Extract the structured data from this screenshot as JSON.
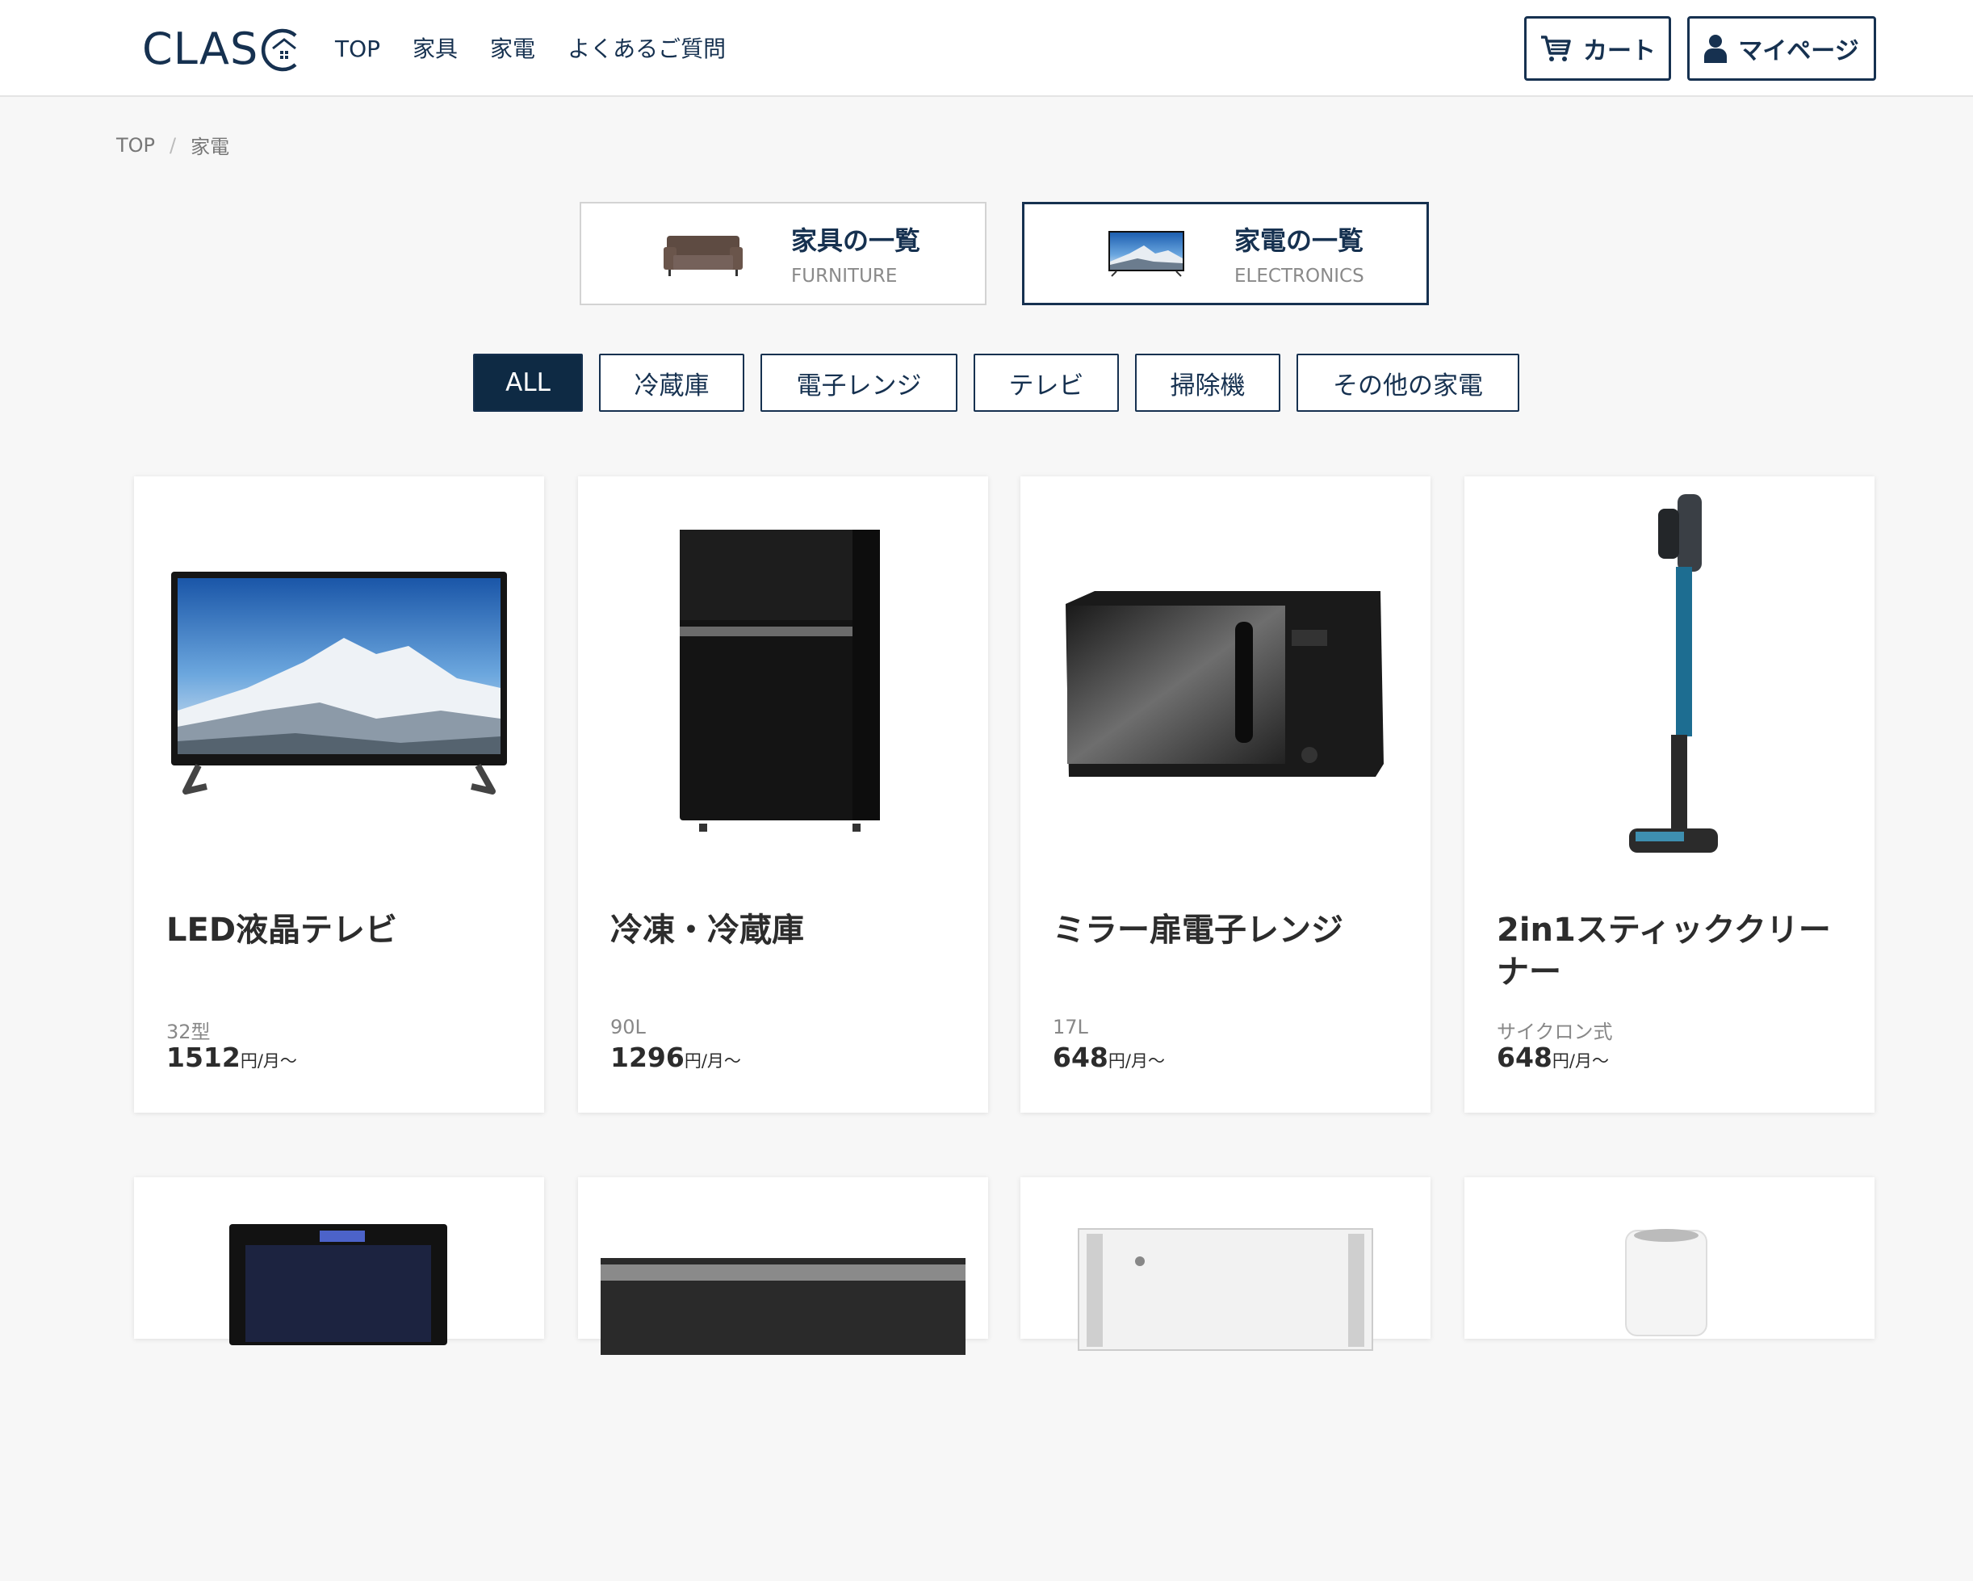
{
  "header": {
    "logo": "CLAS",
    "nav": [
      "TOP",
      "家具",
      "家電",
      "よくあるご質問"
    ],
    "cart_label": "カート",
    "mypage_label": "マイページ"
  },
  "breadcrumb": {
    "home": "TOP",
    "sep": "/",
    "current": "家電"
  },
  "categories": [
    {
      "jp": "家具の一覧",
      "en": "FURNITURE"
    },
    {
      "jp": "家電の一覧",
      "en": "ELECTRONICS"
    }
  ],
  "filters": [
    "ALL",
    "冷蔵庫",
    "電子レンジ",
    "テレビ",
    "掃除機",
    "その他の家電"
  ],
  "products": [
    {
      "name": "LED液晶テレビ",
      "spec": "32型",
      "price": "1512",
      "unit": "円/月〜"
    },
    {
      "name": "冷凍・冷蔵庫",
      "spec": "90L",
      "price": "1296",
      "unit": "円/月〜"
    },
    {
      "name": "ミラー扉電子レンジ",
      "spec": "17L",
      "price": "648",
      "unit": "円/月〜"
    },
    {
      "name": "2in1スティッククリーナー",
      "spec": "サイクロン式",
      "price": "648",
      "unit": "円/月〜"
    }
  ],
  "colors": {
    "brand": "#163150",
    "active_bg": "#0e2a44"
  }
}
